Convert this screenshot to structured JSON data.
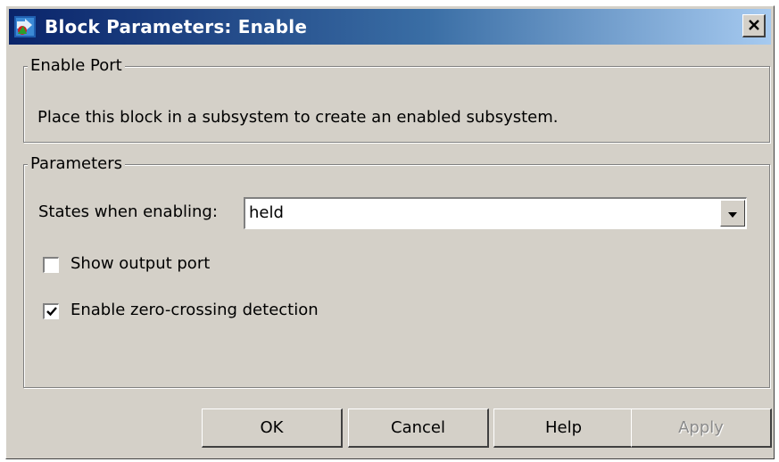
{
  "window": {
    "title": "Block Parameters: Enable",
    "title_icon": "simulink-block-icon",
    "close_icon": "close-icon"
  },
  "enable_port": {
    "legend": "Enable Port",
    "description": "Place this block in a subsystem to create an enabled subsystem."
  },
  "parameters": {
    "legend": "Parameters",
    "states_label": "States when enabling:",
    "states_value": "held",
    "show_output_port": {
      "label": "Show output port",
      "checked": false
    },
    "zero_crossing": {
      "label": "Enable zero-crossing detection",
      "checked": true
    }
  },
  "buttons": {
    "ok": "OK",
    "cancel": "Cancel",
    "help": "Help",
    "apply": "Apply"
  },
  "colors": {
    "title_start": "#0a246a",
    "title_end": "#a6caf0",
    "face": "#d4d0c8"
  }
}
